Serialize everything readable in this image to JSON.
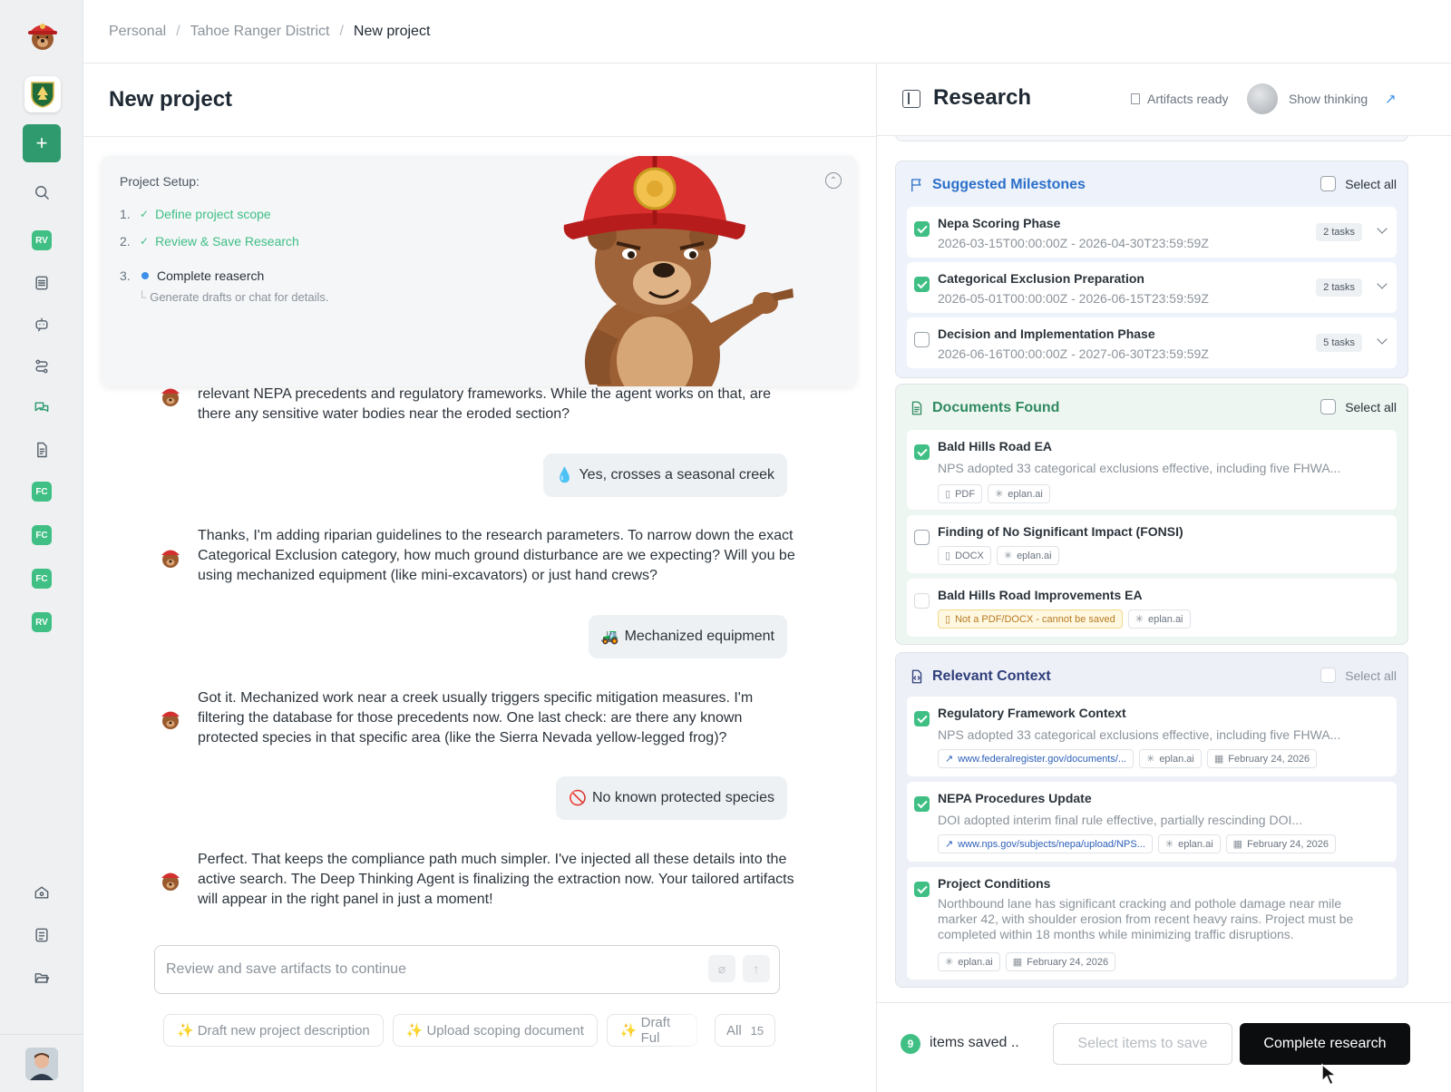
{
  "breadcrumb": [
    "Personal",
    "Tahoe Ranger District",
    "New project"
  ],
  "rail": {
    "logo": "bear-mascot-icon",
    "org": "usfs-shield-icon",
    "badges": [
      "RV",
      "FC",
      "FC",
      "FC",
      "RV"
    ]
  },
  "left": {
    "title": "New project",
    "setup": {
      "title": "Project Setup:",
      "steps": [
        {
          "num": "1.",
          "label": "Define project scope",
          "state": "done"
        },
        {
          "num": "2.",
          "label": "Review & Save Research",
          "state": "done"
        },
        {
          "num": "3.",
          "label": "Complete reaserch",
          "state": "active"
        }
      ],
      "sub": "Generate drafts or chat for details."
    },
    "messages": [
      {
        "role": "agent",
        "text": "relevant NEPA precedents and regulatory frameworks. While the agent works on that, are there any sensitive water bodies near the eroded section?"
      },
      {
        "role": "user",
        "icon": "💧",
        "text": "Yes, crosses a seasonal creek"
      },
      {
        "role": "agent",
        "text": "Thanks, I'm adding riparian guidelines to the research parameters. To narrow down the exact Categorical Exclusion category, how much ground disturbance are we expecting? Will you be using mechanized equipment (like mini-excavators) or just hand crews?"
      },
      {
        "role": "user",
        "icon": "🚜",
        "text": "Mechanized equipment"
      },
      {
        "role": "agent",
        "text": "Got it. Mechanized work near a creek usually triggers specific mitigation measures. I'm filtering the database for those precedents now. One last check: are there any known protected species in that specific area (like the Sierra Nevada yellow-legged frog)?"
      },
      {
        "role": "user",
        "icon": "🚫",
        "text": "No known protected species"
      },
      {
        "role": "agent",
        "text": "Perfect. That keeps the compliance path much simpler. I've injected all these details into the active search. The Deep Thinking Agent is finalizing the extraction now. Your tailored artifacts will appear in the right panel in just a moment!"
      }
    ],
    "input_placeholder": "Review and save artifacts to continue",
    "chips": [
      "Draft new project description",
      "Upload scoping document",
      "Draft Ful"
    ],
    "chip_all": {
      "label": "All",
      "count": "15"
    }
  },
  "right": {
    "title": "Research",
    "artifacts": "Artifacts ready",
    "show_thinking": "Show thinking",
    "select_all": "Select all",
    "milestones": {
      "title": "Suggested Milestones",
      "items": [
        {
          "title": "Nepa Scoring Phase",
          "dates": "2026-03-15T00:00:00Z - 2026-04-30T23:59:59Z",
          "tasks": "2 tasks",
          "checked": true
        },
        {
          "title": "Categorical Exclusion Preparation",
          "dates": "2026-05-01T00:00:00Z - 2026-06-15T23:59:59Z",
          "tasks": "2 tasks",
          "checked": true
        },
        {
          "title": "Decision and Implementation Phase",
          "dates": "2026-06-16T00:00:00Z - 2027-06-30T23:59:59Z",
          "tasks": "5 tasks",
          "checked": false
        }
      ]
    },
    "documents": {
      "title": "Documents Found",
      "items": [
        {
          "title": "Bald Hills Road EA",
          "desc": "NPS adopted 33 categorical exclusions effective, including five FHWA...",
          "tags": [
            "PDF",
            "eplan.ai"
          ],
          "checked": true
        },
        {
          "title": "Finding of No Significant Impact (FONSI)",
          "tags": [
            "DOCX",
            "eplan.ai"
          ],
          "checked": false
        },
        {
          "title": "Bald Hills Road Improvements EA",
          "tags": [
            "Not a PDF/DOCX - cannot be saved",
            "eplan.ai"
          ],
          "checked": false
        }
      ]
    },
    "context": {
      "title": "Relevant Context",
      "items": [
        {
          "title": "Regulatory Framework Context",
          "desc": "NPS adopted 33 categorical exclusions effective, including five FHWA...",
          "tags": [
            "www.federalregister.gov/documents/...",
            "eplan.ai",
            "February 24, 2026"
          ],
          "checked": true
        },
        {
          "title": "NEPA Procedures Update",
          "desc": "DOI adopted interim final rule effective, partially rescinding DOI...",
          "tags": [
            "www.nps.gov/subjects/nepa/upload/NPS...",
            "eplan.ai",
            "February 24, 2026"
          ],
          "checked": true
        },
        {
          "title": "Project Conditions",
          "desc": "Northbound lane has significant cracking and pothole damage near mile marker 42, with shoulder erosion from recent heavy rains. Project must be completed within 18 months while minimizing traffic disruptions.",
          "tags": [
            "eplan.ai",
            "February 24, 2026"
          ],
          "checked": true
        }
      ]
    },
    "footer": {
      "saved_count": "9",
      "saved_label": "items saved ..",
      "select_btn": "Select items to save",
      "complete_btn": "Complete research"
    }
  },
  "colors": {
    "accent_green": "#3fbf84",
    "milestone_blue": "#2c6fc9",
    "documents_green": "#2f8a5f",
    "context_navy": "#2e3f7a",
    "primary_button": "#0b0d0f"
  }
}
